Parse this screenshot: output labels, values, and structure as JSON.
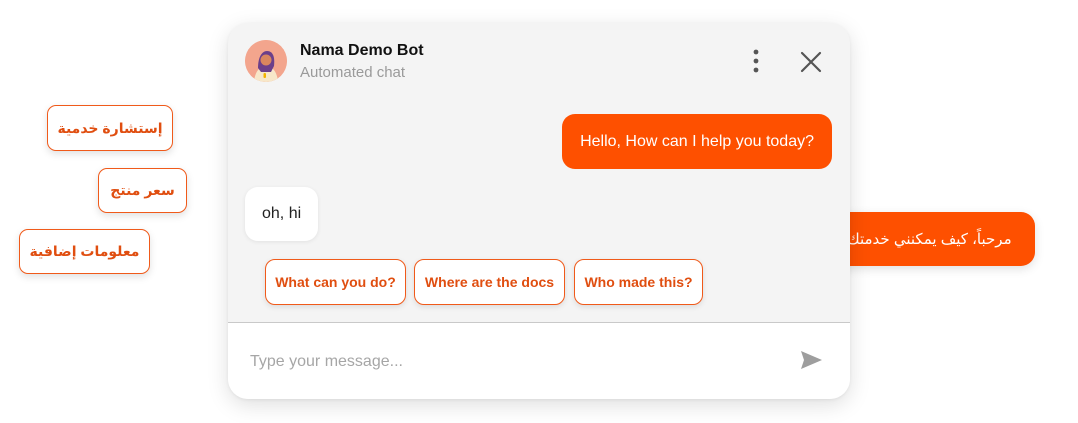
{
  "floating_chips": [
    {
      "label": "إستشارة خدمية"
    },
    {
      "label": "سعر منتج"
    },
    {
      "label": "معلومات إضافية"
    }
  ],
  "floating_bubble": {
    "text": "مرحباً، كيف يمكنني خدمتك؟"
  },
  "chat": {
    "bot_name": "Nama Demo Bot",
    "bot_subtitle": "Automated chat",
    "messages": [
      {
        "from": "bot",
        "text": "Hello, How can I help you today?"
      },
      {
        "from": "user",
        "text": "oh, hi"
      }
    ],
    "quick_replies": [
      {
        "label": "What can you do?"
      },
      {
        "label": "Where are the docs"
      },
      {
        "label": "Who made this?"
      }
    ],
    "input": {
      "value": "",
      "placeholder": "Type your message..."
    },
    "icons": {
      "menu": "vertical-dots-icon",
      "close": "close-icon",
      "send": "send-icon",
      "avatar": "bot-avatar-icon"
    },
    "colors": {
      "accent": "#fe5000",
      "card_bg": "#f4f4f4",
      "input_bg": "#ffffff"
    }
  }
}
